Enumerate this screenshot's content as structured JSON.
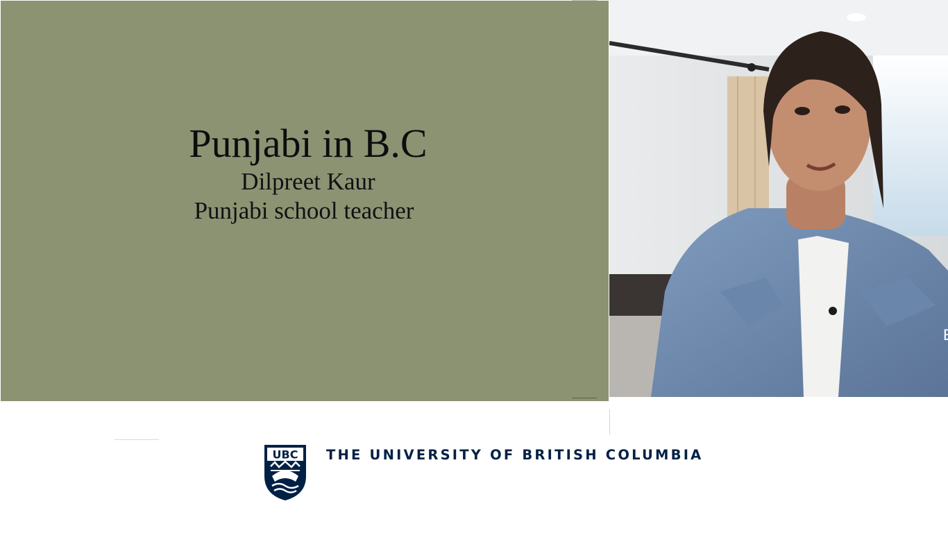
{
  "slide": {
    "title": "Punjabi in B.C",
    "name": "Dilpreet Kaur",
    "role": "Punjabi school teacher",
    "background_color": "#8b9373"
  },
  "video": {
    "content": "speaker-webcam-feed"
  },
  "footer": {
    "logo_text": "UBC",
    "institution": "THE UNIVERSITY OF BRITISH COLUMBIA",
    "brand_color": "#002145"
  }
}
